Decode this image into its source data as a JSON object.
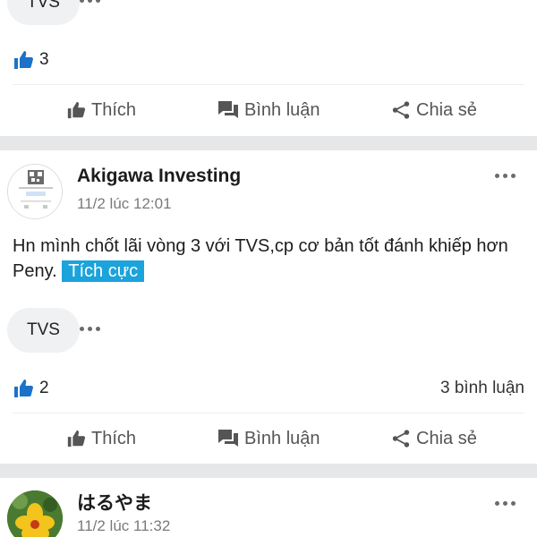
{
  "top_post": {
    "ticker": "TVS",
    "like_count": "3",
    "actions": {
      "like": "Thích",
      "comment": "Bình luận",
      "share": "Chia sẻ"
    }
  },
  "post": {
    "author": "Akigawa Investing",
    "time": "11/2 lúc 12:01",
    "text": "Hn mình chốt lãi vòng 3 với TVS,cp cơ bản tốt đánh khiếp hơn Peny.",
    "sentiment": "Tích cực",
    "sentiment_color": "#1ba3dc",
    "ticker": "TVS",
    "like_count": "2",
    "comment_count": "3 bình luận",
    "actions": {
      "like": "Thích",
      "comment": "Bình luận",
      "share": "Chia sẻ"
    }
  },
  "next_post": {
    "author": "はるやま",
    "time": "11/2 lúc 11:32"
  },
  "colors": {
    "like_blue": "#1a73c8",
    "separator": "#e6e7e9"
  },
  "icons": [
    "more-icon",
    "thumbs-up-icon",
    "comment-icon",
    "share-icon"
  ]
}
